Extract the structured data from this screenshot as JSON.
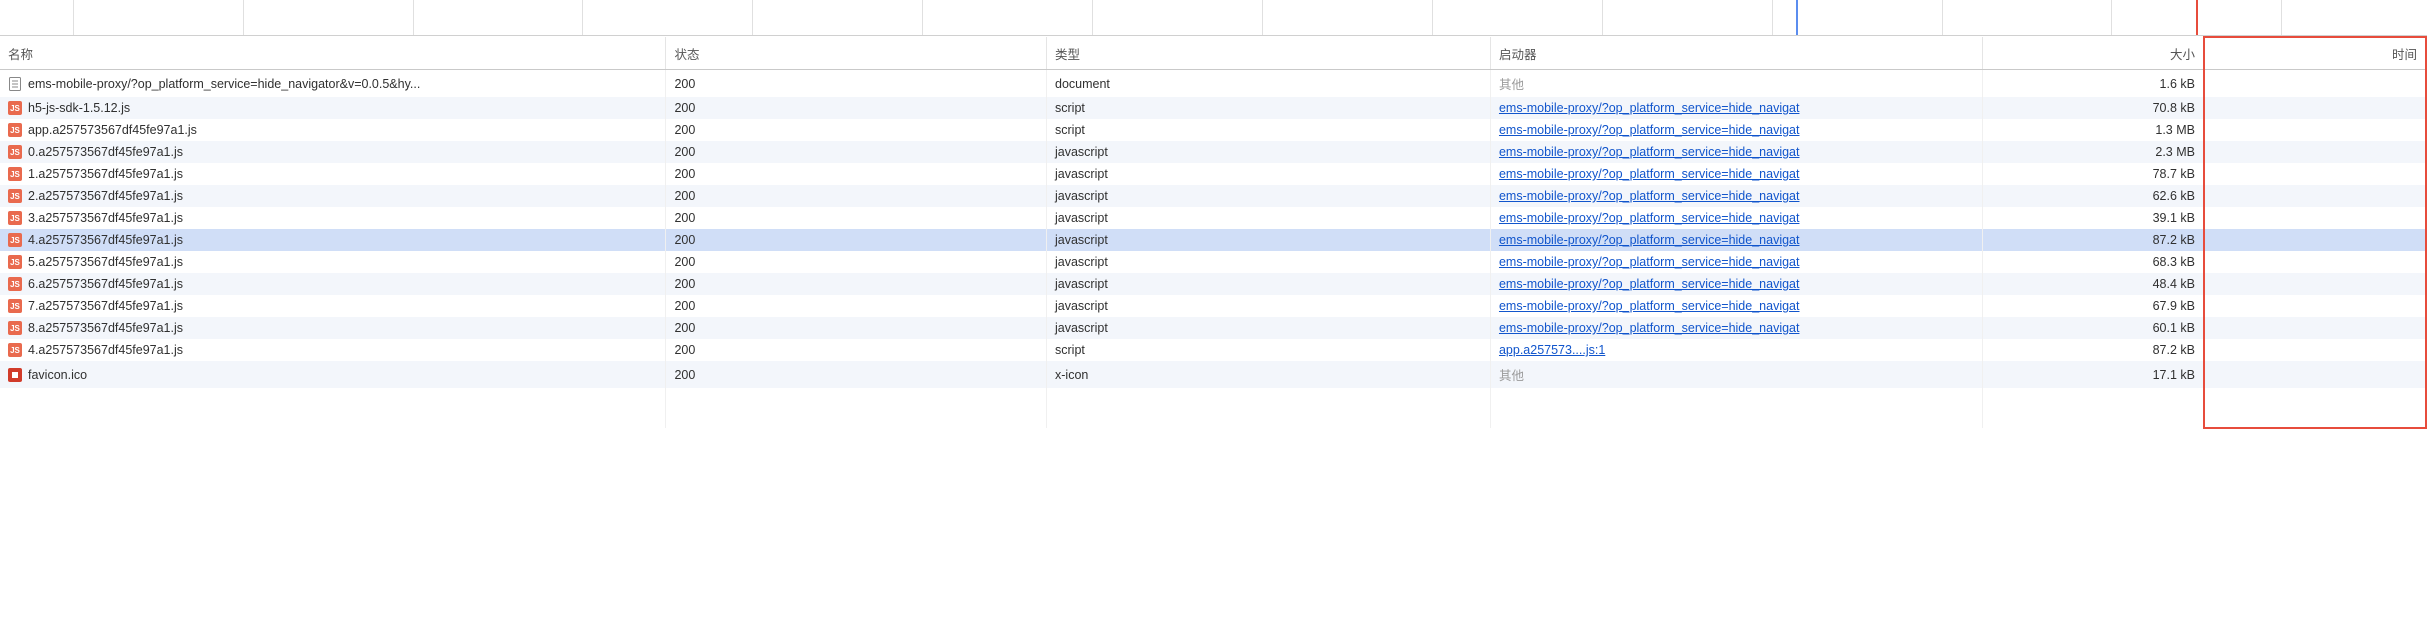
{
  "headers": {
    "name": "名称",
    "status": "状态",
    "type": "类型",
    "initiator": "启动器",
    "size": "大小",
    "time": "时间"
  },
  "initiator_other_label": "其他",
  "initiator_link_label": "ems-mobile-proxy/?op_platform_service=hide_navigat",
  "rows": [
    {
      "icon": "doc",
      "name": "ems-mobile-proxy/?op_platform_service=hide_navigator&v=0.0.5&hy...",
      "status": "200",
      "type": "document",
      "initiator_kind": "other",
      "initiator": "其他",
      "size": "1.6 kB",
      "selected": false
    },
    {
      "icon": "js",
      "name": "h5-js-sdk-1.5.12.js",
      "status": "200",
      "type": "script",
      "initiator_kind": "link",
      "initiator": "ems-mobile-proxy/?op_platform_service=hide_navigat",
      "size": "70.8 kB",
      "selected": false
    },
    {
      "icon": "js",
      "name": "app.a257573567df45fe97a1.js",
      "status": "200",
      "type": "script",
      "initiator_kind": "link",
      "initiator": "ems-mobile-proxy/?op_platform_service=hide_navigat",
      "size": "1.3 MB",
      "selected": false
    },
    {
      "icon": "js",
      "name": "0.a257573567df45fe97a1.js",
      "status": "200",
      "type": "javascript",
      "initiator_kind": "link",
      "initiator": "ems-mobile-proxy/?op_platform_service=hide_navigat",
      "size": "2.3 MB",
      "selected": false
    },
    {
      "icon": "js",
      "name": "1.a257573567df45fe97a1.js",
      "status": "200",
      "type": "javascript",
      "initiator_kind": "link",
      "initiator": "ems-mobile-proxy/?op_platform_service=hide_navigat",
      "size": "78.7 kB",
      "selected": false
    },
    {
      "icon": "js",
      "name": "2.a257573567df45fe97a1.js",
      "status": "200",
      "type": "javascript",
      "initiator_kind": "link",
      "initiator": "ems-mobile-proxy/?op_platform_service=hide_navigat",
      "size": "62.6 kB",
      "selected": false
    },
    {
      "icon": "js",
      "name": "3.a257573567df45fe97a1.js",
      "status": "200",
      "type": "javascript",
      "initiator_kind": "link",
      "initiator": "ems-mobile-proxy/?op_platform_service=hide_navigat",
      "size": "39.1 kB",
      "selected": false
    },
    {
      "icon": "js",
      "name": "4.a257573567df45fe97a1.js",
      "status": "200",
      "type": "javascript",
      "initiator_kind": "link",
      "initiator": "ems-mobile-proxy/?op_platform_service=hide_navigat",
      "size": "87.2 kB",
      "selected": true
    },
    {
      "icon": "js",
      "name": "5.a257573567df45fe97a1.js",
      "status": "200",
      "type": "javascript",
      "initiator_kind": "link",
      "initiator": "ems-mobile-proxy/?op_platform_service=hide_navigat",
      "size": "68.3 kB",
      "selected": false
    },
    {
      "icon": "js",
      "name": "6.a257573567df45fe97a1.js",
      "status": "200",
      "type": "javascript",
      "initiator_kind": "link",
      "initiator": "ems-mobile-proxy/?op_platform_service=hide_navigat",
      "size": "48.4 kB",
      "selected": false
    },
    {
      "icon": "js",
      "name": "7.a257573567df45fe97a1.js",
      "status": "200",
      "type": "javascript",
      "initiator_kind": "link",
      "initiator": "ems-mobile-proxy/?op_platform_service=hide_navigat",
      "size": "67.9 kB",
      "selected": false
    },
    {
      "icon": "js",
      "name": "8.a257573567df45fe97a1.js",
      "status": "200",
      "type": "javascript",
      "initiator_kind": "link",
      "initiator": "ems-mobile-proxy/?op_platform_service=hide_navigat",
      "size": "60.1 kB",
      "selected": false
    },
    {
      "icon": "js",
      "name": "4.a257573567df45fe97a1.js",
      "status": "200",
      "type": "script",
      "initiator_kind": "link",
      "initiator": "app.a257573....js:1",
      "size": "87.2 kB",
      "selected": false
    },
    {
      "icon": "fav",
      "name": "favicon.ico",
      "status": "200",
      "type": "x-icon",
      "initiator_kind": "other",
      "initiator": "其他",
      "size": "17.1 kB",
      "selected": false
    }
  ],
  "waterfall_ticks_pct": [
    3,
    10,
    17,
    24,
    31,
    38,
    45,
    52,
    59,
    66,
    73,
    80,
    87,
    94
  ],
  "waterfall_blue_pct": 74,
  "waterfall_red_pct": 90.5
}
